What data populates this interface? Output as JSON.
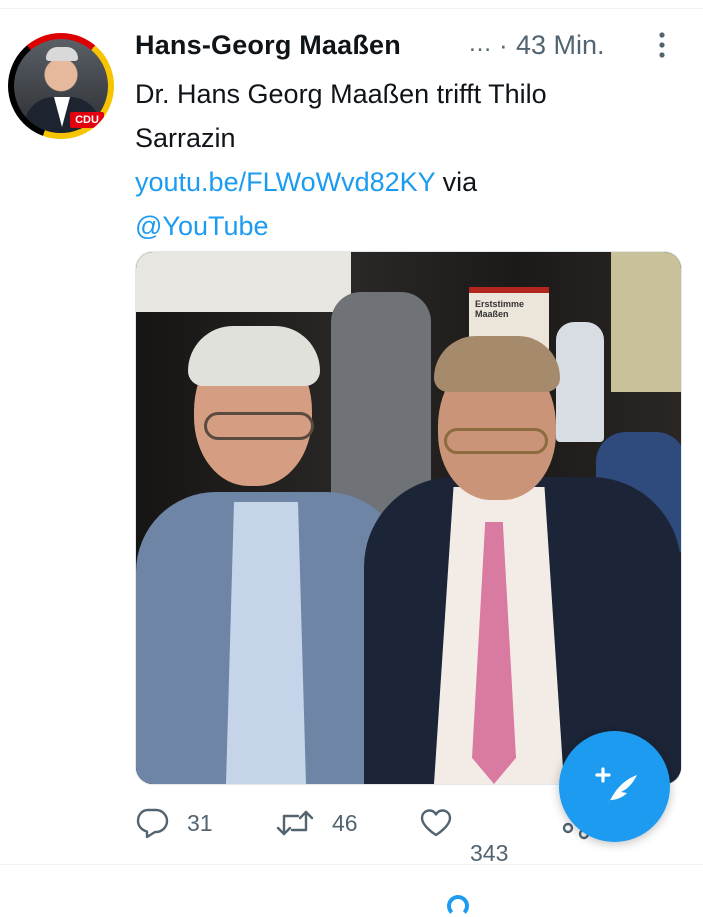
{
  "tweet": {
    "author_name": "Hans-Georg Maaßen",
    "name_ellipsis": "…",
    "separator": "·",
    "timestamp": "43 Min.",
    "text_line1": "Dr. Hans Georg Maaßen trifft Thilo",
    "text_line2": "Sarrazin",
    "link_text": "youtu.be/FLWoWvd82KY",
    "via_text": " via",
    "mention": "@YouTube",
    "avatar_badge": "CDU",
    "banner_text": "Erststimme Maaßen"
  },
  "actions": {
    "reply_count": "31",
    "retweet_count": "46",
    "like_count": "343"
  },
  "icons": {
    "more": "more-vertical-icon",
    "reply": "reply-icon",
    "retweet": "retweet-icon",
    "like": "heart-icon",
    "share": "share-icon",
    "compose": "compose-feather-icon"
  },
  "colors": {
    "accent": "#1d9bf0",
    "muted": "#536471",
    "text": "#0f1419"
  }
}
